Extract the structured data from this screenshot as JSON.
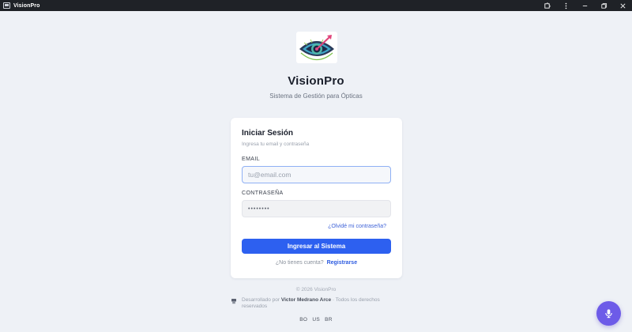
{
  "window": {
    "title": "VisionPro"
  },
  "brand": {
    "title": "VisionPro",
    "subtitle": "Sistema de Gestión para Ópticas"
  },
  "login": {
    "heading": "Iniciar Sesión",
    "subheading": "Ingresa tu email y contraseña",
    "email_label": "EMAIL",
    "email_placeholder": "tu@email.com",
    "password_label": "CONTRASEÑA",
    "password_value": "••••••••",
    "forgot_link": "¿Olvidé mi contraseña?",
    "submit_label": "Ingresar al Sistema",
    "no_account_text": "¿No tienes cuenta?",
    "register_link": "Registrarse"
  },
  "footer": {
    "copyright": "© 2026 VisionPro",
    "developed_by": "Desarrollado por",
    "developer_name": "Victor Medrano Arce",
    "rights": "· Todos los derechos reservados",
    "languages": [
      "BO",
      "US",
      "BR"
    ]
  },
  "colors": {
    "titlebar": "#1f2227",
    "background": "#eef1f6",
    "primary": "#2d60f0",
    "link": "#3f63d8",
    "mic_button": "#6d5be8"
  },
  "icons": {
    "app": "window-icon",
    "extensions": "puzzle-icon",
    "menu": "kebab-menu-icon",
    "minimize": "minimize-icon",
    "maximize": "restore-icon",
    "close": "close-icon",
    "developer": "developer-badge-icon",
    "mic": "microphone-icon"
  }
}
